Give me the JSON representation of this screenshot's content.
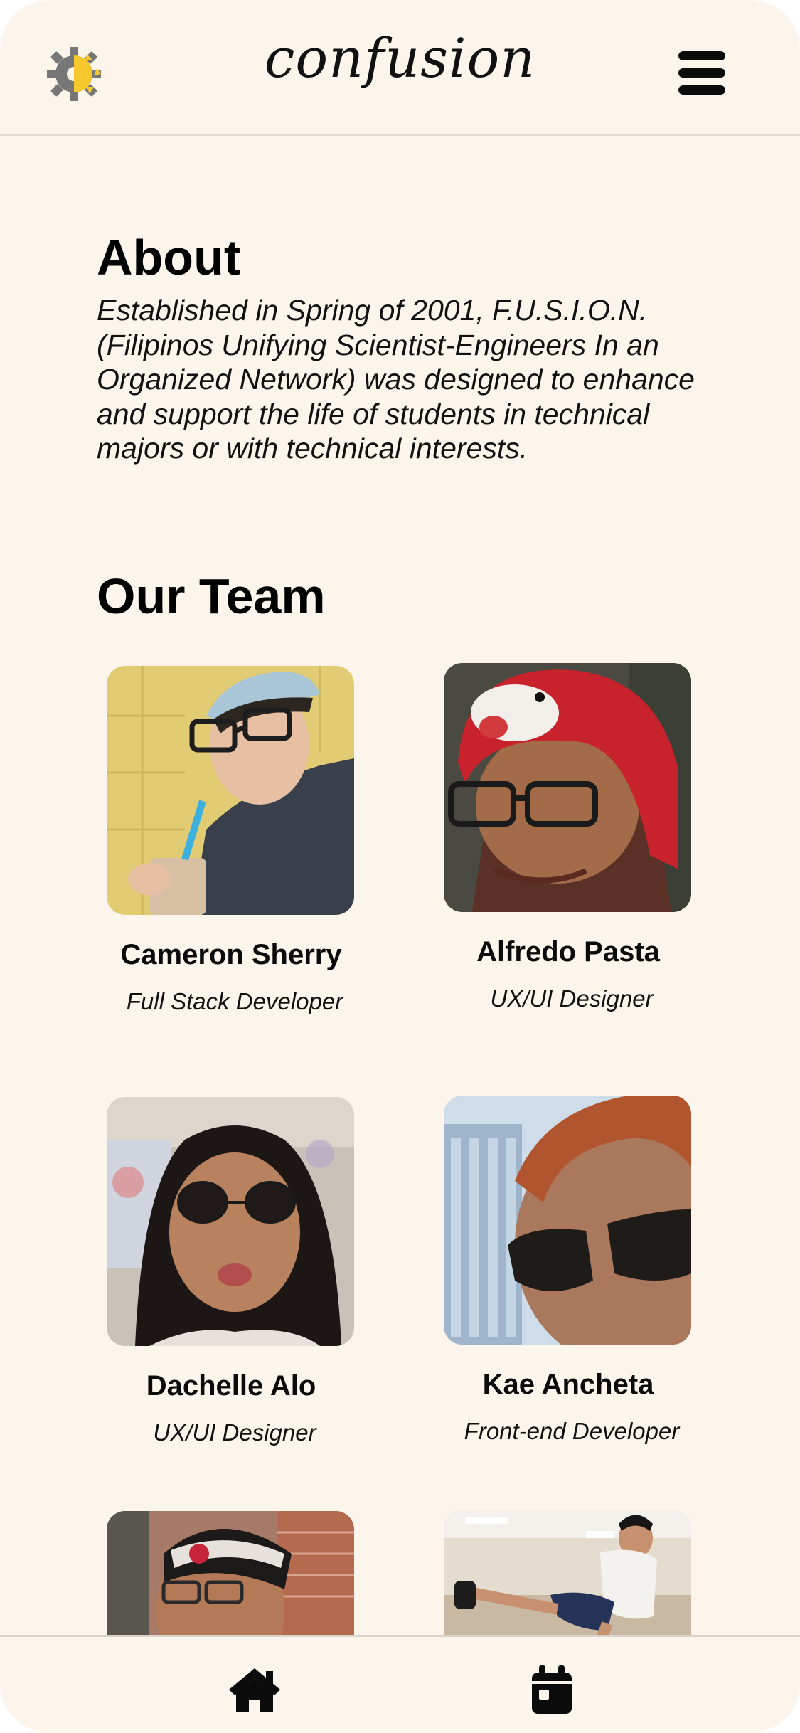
{
  "header": {
    "brand": "confusion",
    "logo_icon": "gear-sun-logo",
    "menu_icon": "hamburger-menu-icon"
  },
  "about": {
    "title": "About",
    "body": "Established in Spring of 2001, F.U.S.I.O.N. (Filipinos Unifying Scientist-Engineers In an Organized Network) was designed to enhance and support the life of students in technical majors or with technical interests."
  },
  "team": {
    "title": "Our Team",
    "members": [
      {
        "name": "Cameron Sherry",
        "role": "Full Stack Developer"
      },
      {
        "name": "Alfredo Pasta",
        "role": "UX/UI Designer"
      },
      {
        "name": "Dachelle Alo",
        "role": "UX/UI Designer"
      },
      {
        "name": "Kae Ancheta",
        "role": "Front-end Developer"
      },
      {
        "name": "",
        "role": ""
      },
      {
        "name": "",
        "role": ""
      }
    ]
  },
  "bottom_nav": {
    "items": [
      {
        "icon": "home-icon"
      },
      {
        "icon": "calendar-icon"
      }
    ]
  },
  "colors": {
    "background": "#fcf5ec",
    "text": "#0b0b0b",
    "logo_gear": "#777777",
    "logo_sun": "#f6c82b"
  }
}
